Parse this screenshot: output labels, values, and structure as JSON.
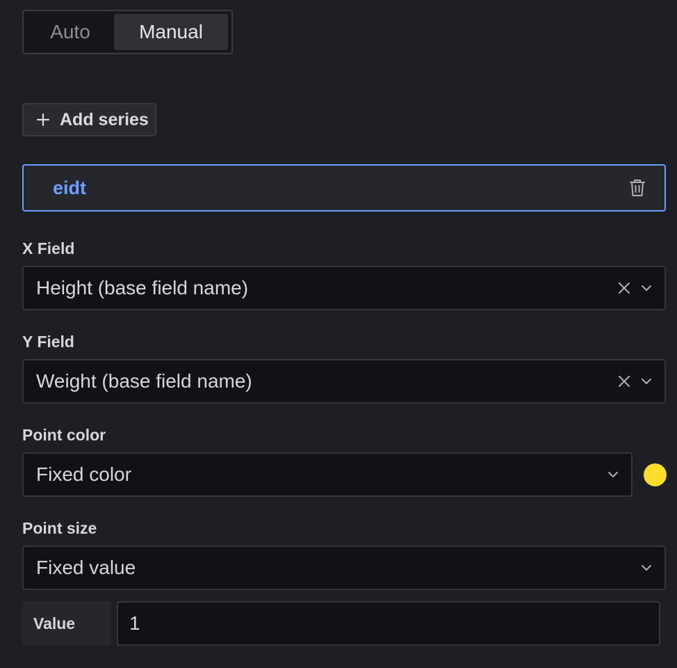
{
  "mode_toggle": {
    "options": [
      "Auto",
      "Manual"
    ],
    "selected": "Manual"
  },
  "add_series": {
    "label": "Add series",
    "icon": "plus-icon"
  },
  "series": [
    {
      "name": "eidt",
      "delete_icon": "trash-icon"
    }
  ],
  "fields": {
    "x_field": {
      "label": "X Field",
      "value": "Height (base field name)"
    },
    "y_field": {
      "label": "Y Field",
      "value": "Weight (base field name)"
    },
    "point_color": {
      "label": "Point color",
      "value": "Fixed color",
      "color": "#fade2a"
    },
    "point_size": {
      "label": "Point size",
      "value": "Fixed value"
    },
    "size_value": {
      "label": "Value",
      "value": "1"
    }
  },
  "colors": {
    "accent": "#6e9fff",
    "background": "#1d1f24",
    "input_bg": "#111216"
  }
}
